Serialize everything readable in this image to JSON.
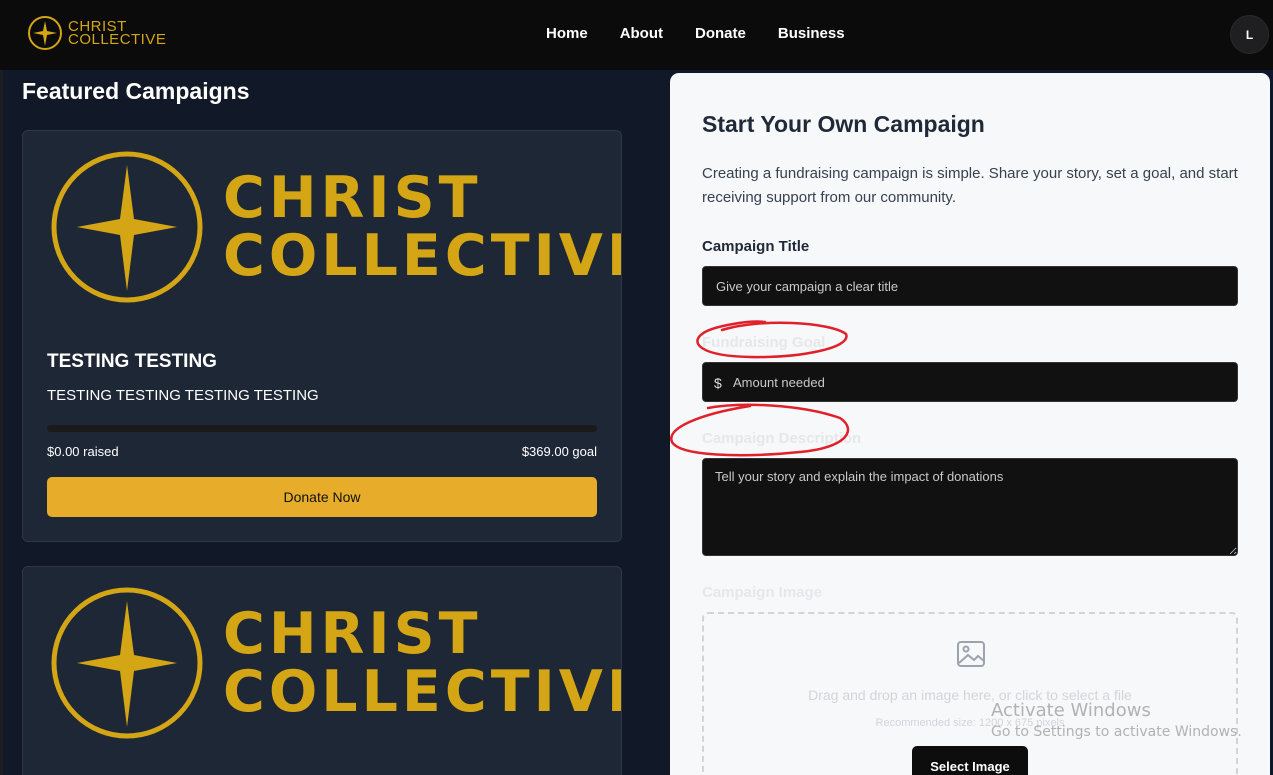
{
  "header": {
    "logo_line1": "CHRIST",
    "logo_line2": "COLLECTIVE",
    "nav": [
      "Home",
      "About",
      "Donate",
      "Business"
    ],
    "avatar_initial": "L"
  },
  "featured": {
    "title": "Featured Campaigns",
    "campaigns": [
      {
        "logo_line1": "CHRIST",
        "logo_line2": "COLLECTIVE",
        "title": "TESTING TESTING",
        "description": "TESTING TESTING TESTING TESTING",
        "raised": "$0.00 raised",
        "goal": "$369.00 goal",
        "progress": 0,
        "button": "Donate Now"
      },
      {
        "logo_line1": "CHRIST",
        "logo_line2": "COLLECTIVE"
      }
    ]
  },
  "form": {
    "title": "Start Your Own Campaign",
    "intro": "Creating a fundraising campaign is simple. Share your story, set a goal, and start receiving support from our community.",
    "campaign_title_label": "Campaign Title",
    "campaign_title_placeholder": "Give your campaign a clear title",
    "goal_label": "Fundraising Goal",
    "currency_symbol": "$",
    "goal_placeholder": "Amount needed",
    "description_label": "Campaign Description",
    "description_placeholder": "Tell your story and explain the impact of donations",
    "image_label": "Campaign Image",
    "dropzone_text": "Drag and drop an image here, or click to select a file",
    "dropzone_sub": "Recommended size: 1200 x 675 pixels",
    "select_button": "Select Image"
  },
  "watermark": {
    "line1": "Activate Windows",
    "line2": "Go to Settings to activate Windows."
  },
  "colors": {
    "brand_gold": "#d4a514",
    "button_gold": "#e6ac2a",
    "annotation_red": "#e0202a"
  }
}
